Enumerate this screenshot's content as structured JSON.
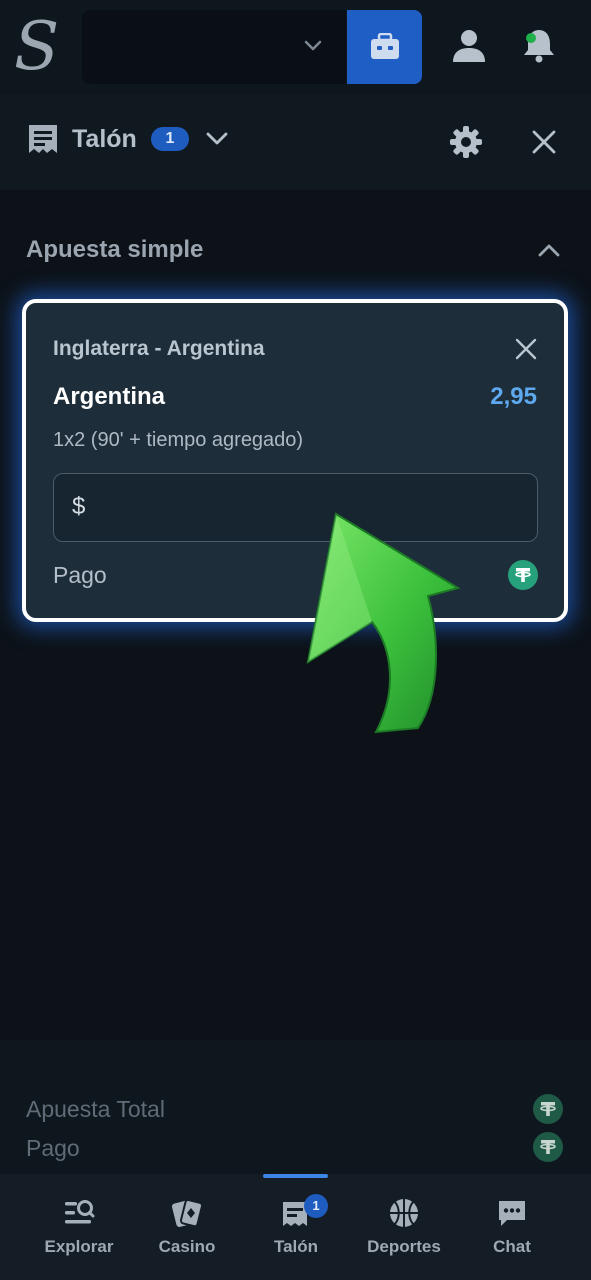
{
  "header": {
    "logo_letter": "S",
    "icons": [
      "chevron-down-icon",
      "wallet-icon",
      "user-icon",
      "bell-icon"
    ],
    "notification_dot_color": "#1fb04b"
  },
  "slip": {
    "title": "Talón",
    "count": "1"
  },
  "section": {
    "title": "Apuesta simple"
  },
  "bet": {
    "match": "Inglaterra - Argentina",
    "selection": "Argentina",
    "odds": "2,95",
    "market": "1x2 (90' + tiempo agregado)",
    "stake_currency": "$",
    "payout_label": "Pago",
    "token_symbol": "₮"
  },
  "totals": {
    "total_stake_label": "Apuesta Total",
    "payout_label": "Pago"
  },
  "nav": {
    "items": [
      {
        "label": "Explorar",
        "icon": "explore-icon"
      },
      {
        "label": "Casino",
        "icon": "casino-cards-icon"
      },
      {
        "label": "Talón",
        "icon": "betslip-icon",
        "badge": "1",
        "active": true
      },
      {
        "label": "Deportes",
        "icon": "basketball-icon"
      },
      {
        "label": "Chat",
        "icon": "chat-icon"
      }
    ]
  },
  "colors": {
    "background": "#0c1218",
    "accent_blue": "#1f5ec4",
    "odds_blue": "#5ea8ee",
    "card_bg": "#1d2e3a",
    "tether_green": "#26a17b",
    "arrow_green": "#3fbf3f"
  }
}
